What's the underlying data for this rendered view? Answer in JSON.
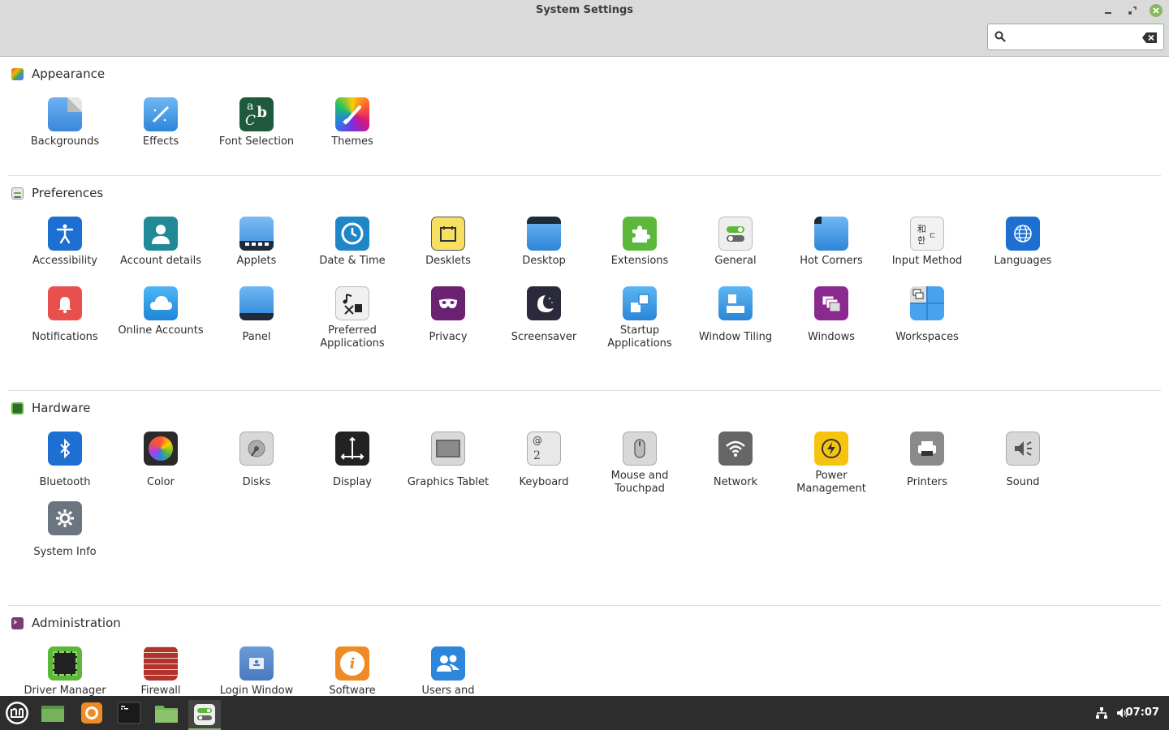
{
  "window": {
    "title": "System Settings"
  },
  "search": {
    "placeholder": ""
  },
  "sections": [
    {
      "title": "Appearance",
      "color": "#e8504e",
      "items": [
        {
          "label": "Backgrounds",
          "icon": "backgrounds-icon"
        },
        {
          "label": "Effects",
          "icon": "effects-icon"
        },
        {
          "label": "Font Selection",
          "icon": "font-selection-icon"
        },
        {
          "label": "Themes",
          "icon": "themes-icon"
        }
      ]
    },
    {
      "title": "Preferences",
      "color": "#6aa84f",
      "items": [
        {
          "label": "Accessibility",
          "icon": "accessibility-icon"
        },
        {
          "label": "Account details",
          "icon": "account-details-icon"
        },
        {
          "label": "Applets",
          "icon": "applets-icon"
        },
        {
          "label": "Date & Time",
          "icon": "date-time-icon"
        },
        {
          "label": "Desklets",
          "icon": "desklets-icon"
        },
        {
          "label": "Desktop",
          "icon": "desktop-icon"
        },
        {
          "label": "Extensions",
          "icon": "extensions-icon"
        },
        {
          "label": "General",
          "icon": "general-icon"
        },
        {
          "label": "Hot Corners",
          "icon": "hot-corners-icon"
        },
        {
          "label": "Input Method",
          "icon": "input-method-icon"
        },
        {
          "label": "Languages",
          "icon": "languages-icon"
        },
        {
          "label": "Notifications",
          "icon": "notifications-icon"
        },
        {
          "label": "Online Accounts",
          "icon": "online-accounts-icon"
        },
        {
          "label": "Panel",
          "icon": "panel-icon"
        },
        {
          "label": "Preferred Applications",
          "icon": "preferred-applications-icon"
        },
        {
          "label": "Privacy",
          "icon": "privacy-icon"
        },
        {
          "label": "Screensaver",
          "icon": "screensaver-icon"
        },
        {
          "label": "Startup Applications",
          "icon": "startup-applications-icon"
        },
        {
          "label": "Window Tiling",
          "icon": "window-tiling-icon"
        },
        {
          "label": "Windows",
          "icon": "windows-icon"
        },
        {
          "label": "Workspaces",
          "icon": "workspaces-icon"
        }
      ]
    },
    {
      "title": "Hardware",
      "color": "#4f8a3a",
      "items": [
        {
          "label": "Bluetooth",
          "icon": "bluetooth-icon"
        },
        {
          "label": "Color",
          "icon": "color-icon"
        },
        {
          "label": "Disks",
          "icon": "disks-icon"
        },
        {
          "label": "Display",
          "icon": "display-icon"
        },
        {
          "label": "Graphics Tablet",
          "icon": "graphics-tablet-icon"
        },
        {
          "label": "Keyboard",
          "icon": "keyboard-icon"
        },
        {
          "label": "Mouse and Touchpad",
          "icon": "mouse-touchpad-icon"
        },
        {
          "label": "Network",
          "icon": "network-icon"
        },
        {
          "label": "Power Management",
          "icon": "power-management-icon"
        },
        {
          "label": "Printers",
          "icon": "printers-icon"
        },
        {
          "label": "Sound",
          "icon": "sound-icon"
        },
        {
          "label": "System Info",
          "icon": "system-info-icon"
        }
      ]
    },
    {
      "title": "Administration",
      "color": "#7b3b73",
      "items": [
        {
          "label": "Driver Manager",
          "icon": "driver-manager-icon"
        },
        {
          "label": "Firewall",
          "icon": "firewall-icon"
        },
        {
          "label": "Login Window",
          "icon": "login-window-icon"
        },
        {
          "label": "Software",
          "icon": "software-icon"
        },
        {
          "label": "Users and",
          "icon": "users-groups-icon"
        }
      ]
    }
  ],
  "taskbar": {
    "clock": "07:07",
    "buttons": [
      "menu-icon",
      "show-desktop-icon",
      "firefox-icon",
      "terminal-icon",
      "files-icon",
      "system-settings-icon"
    ],
    "tray": [
      "network-tray-icon",
      "volume-tray-icon"
    ]
  }
}
